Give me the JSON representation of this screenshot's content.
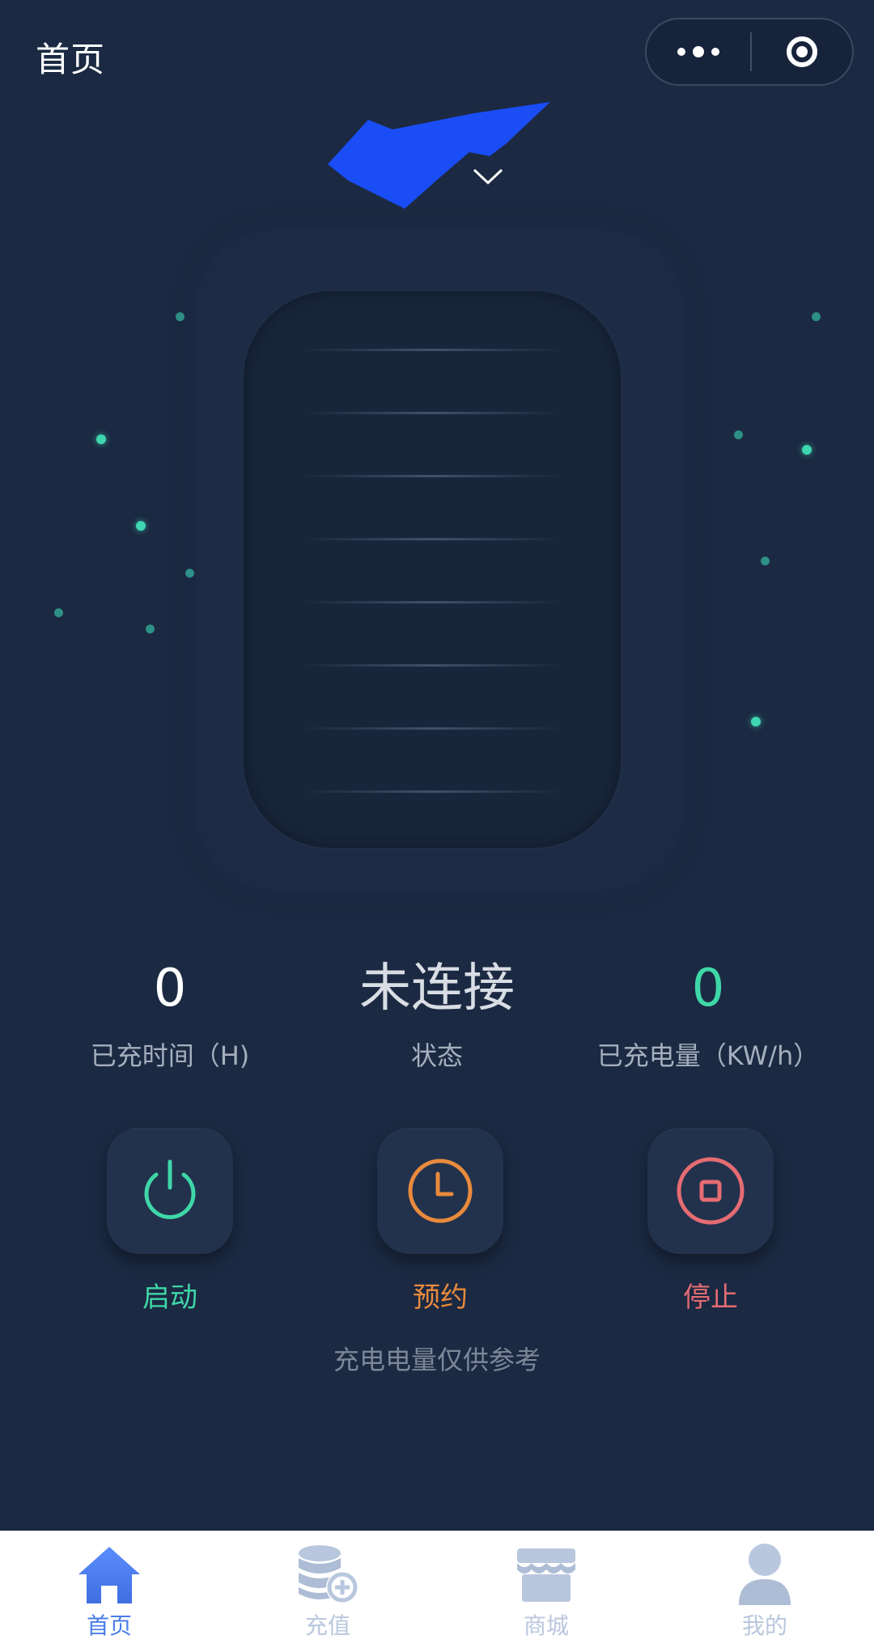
{
  "theme": {
    "background": "#1b2942",
    "accent_green": "#3fd7a8",
    "accent_orange": "#e98a3c",
    "accent_red": "#e56c72",
    "tab_active": "#4a7dea",
    "tab_inactive": "#b9c7de"
  },
  "header": {
    "title": "首页",
    "more_icon": "more-dots-icon",
    "capsule_icon": "target-icon"
  },
  "device_selector": {
    "icon": "chevron-down-icon"
  },
  "stats": {
    "charged_time": {
      "value": "0",
      "label": "已充时间（H)"
    },
    "status": {
      "value": "未连接",
      "label": "状态"
    },
    "charged_energy": {
      "value": "0",
      "label": "已充电量（KW/h）"
    }
  },
  "actions": {
    "start": {
      "label": "启动",
      "icon": "power-icon",
      "color": "#3fd7a8"
    },
    "schedule": {
      "label": "预约",
      "icon": "clock-icon",
      "color": "#e98a3c"
    },
    "stop": {
      "label": "停止",
      "icon": "stop-icon",
      "color": "#e56c72"
    }
  },
  "notice": "充电电量仅供参考",
  "tabbar": {
    "items": [
      {
        "label": "首页",
        "icon": "home-icon",
        "active": true
      },
      {
        "label": "充值",
        "icon": "coins-add-icon",
        "active": false
      },
      {
        "label": "商城",
        "icon": "store-icon",
        "active": false
      },
      {
        "label": "我的",
        "icon": "user-icon",
        "active": false
      }
    ]
  }
}
